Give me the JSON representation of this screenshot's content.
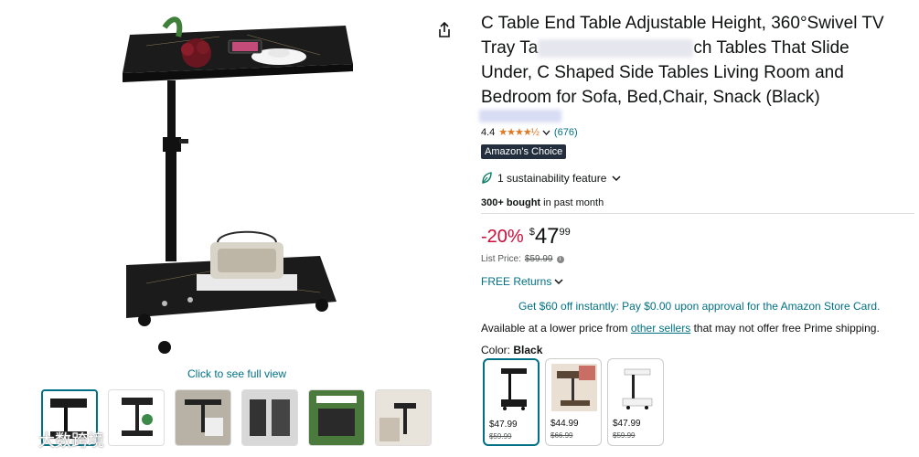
{
  "product": {
    "title": "C Table End Table Adjustable Height, 360°Swivel TV Tray Table, ... Tables That Slide Under, C Shaped Side Tables Living Room and Bedroom for Sofa, Bed,Chair, Snack (Black)",
    "title_line1": "C Table End Table Adjustable Height, 360°Swivel TV",
    "title_line2a": "Tray Ta",
    "title_line2b": "ch Tables That Slide",
    "title_line3": "Under, C Shaped Side Tables Living Room and",
    "title_line4": "Bedroom for Sofa, Bed,Chair, Snack (Black)",
    "rating": "4.4",
    "stars": "★★★★½",
    "review_count": "(676)",
    "badge": "Amazon's Choice",
    "sustainability": "1 sustainability feature",
    "bought_bold": "300+ bought",
    "bought_rest": " in past month",
    "discount": "-20%",
    "currency": "$",
    "price_whole": "47",
    "price_fraction": "99",
    "list_price_label": "List Price:",
    "list_price": "$59.99",
    "free_returns": "FREE Returns",
    "store_card": "Get $60 off instantly: Pay $0.00 upon approval for the Amazon Store Card.",
    "lower_price_pre": "Available at a lower price from ",
    "lower_price_link": "other sellers",
    "lower_price_post": " that may not offer free Prime shipping.",
    "color_label": "Color: ",
    "color_value": "Black",
    "see_full_view": "Click to see full view"
  },
  "swatches": [
    {
      "price": "$47.99",
      "list": "$59.99"
    },
    {
      "price": "$44.99",
      "list": "$66.99"
    },
    {
      "price": "$47.99",
      "list": "$59.99"
    }
  ],
  "watermark": "大数跨境",
  "colors": {
    "link": "#007185",
    "discount": "#cc0c39",
    "star": "#de7921",
    "badge_bg": "#232f3e"
  }
}
